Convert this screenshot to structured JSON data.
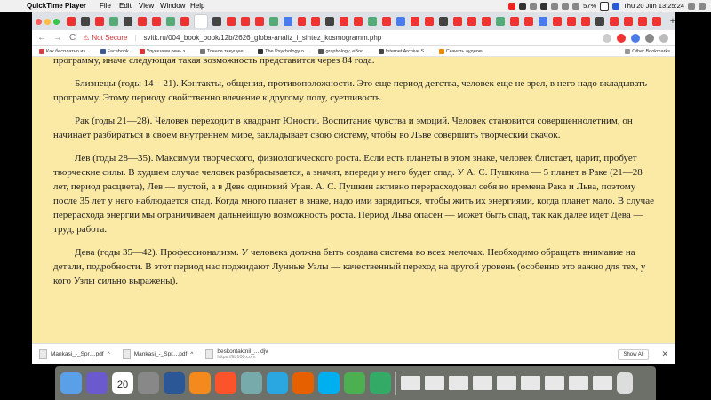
{
  "menubar": {
    "app_name": "QuickTime Player",
    "menus": [
      "File",
      "Edit",
      "View",
      "Window",
      "Help"
    ],
    "battery": "57%",
    "datetime": "Thu 20 Jun  13:25:24"
  },
  "browser": {
    "nav_back": "←",
    "nav_forward": "→",
    "nav_reload": "C",
    "security": "Not Secure",
    "url": "svitk.ru/004_book_book/12b/2626_globa-analiz_i_sintez_kosmogramm.php",
    "bookmarks": [
      "Как бесплатно из...",
      "Facebook",
      "Улучшаем речь з...",
      "Точное текущее...",
      "The Psychology o...",
      "graphology, eBoo...",
      "Internet Archive S...",
      "Скачать аудиокн..."
    ],
    "other_bookmarks": "Other Bookmarks"
  },
  "article": {
    "p0": "программу, иначе следующая такая возможность представится через 84 года.",
    "p1": "Близнецы (годы 14—21). Контакты, общения, противоположности. Это еще период детства, человек еще не зрел, в него надо вкладывать программу. Этому периоду свойственно влечение к другому полу, суетливость.",
    "p2": "Рак (годы 21—28). Человек переходит в квадрант Юности. Воспитание чувства и эмоций. Человек становится совершеннолетним, он начинает разбираться в своем внутреннем мире, закладывает свою систему, чтобы во Льве совершить творческий скачок.",
    "p3": "Лев (годы 28—35). Максимум творческого, физиологического роста. Если есть планеты в этом знаке, человек блистает, царит, пробует творческие силы. В худшем случае человек разбрасывается, а значит, впереди у него будет спад. У А. С. Пушкина — 5 планет в Раке (21—28 лет, период расцвета), Лев — пустой, а в Деве одинокий Уран. А. С. Пушкин активно перерасходовал себя во времена Рака и Льва, поэтому после 35 лет у него наблюдается спад. Когда много планет в знаке, надо ими зарядиться, чтобы жить их энергиями, когда планет мало. В случае перерасхода энергии мы ограничиваем дальнейшую возможность роста. Период Льва опасен — может быть спад, так как далее идет Дева — труд, работа.",
    "p4": "Дева (годы 35—42). Профессионализм. У человека должна быть создана система во всех мелочах. Необходимо обращать внимание на детали, подробности. В этот период нас поджидают Лунные Узлы — качественный переход на другой уровень (особенно это важно для тех, у кого Узлы сильно выражены)."
  },
  "downloads": {
    "items": [
      {
        "name": "Mankasi_-_Spr....pdf",
        "sub": ""
      },
      {
        "name": "Mankasi_-_Spr....pdf",
        "sub": ""
      },
      {
        "name": "beskontaktnil_....djv",
        "sub": "https://lib100.com"
      }
    ],
    "show_all": "Show All",
    "close": "✕"
  },
  "dock": {
    "calendar_day": "20"
  },
  "colors": {
    "page_background": "#fbeaa6",
    "dock": "#6c7068"
  }
}
